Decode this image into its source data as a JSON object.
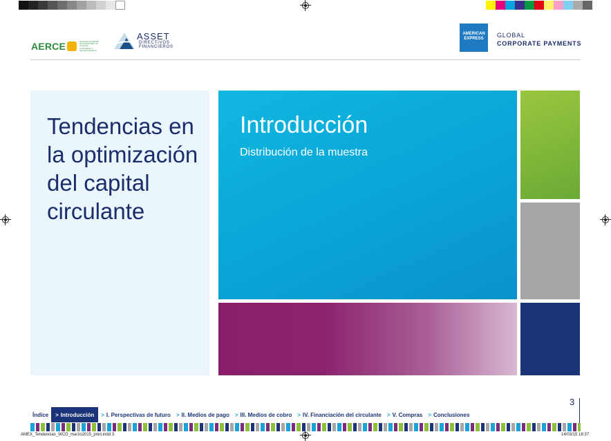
{
  "header": {
    "aerce_logo": "AERCE",
    "aerce_tagline": "Asociación Española de Profesionales de Compras, Contratación y Aprovisionamiento",
    "asset_logo": "ASSET",
    "asset_sub1": "DIRECTIVOS",
    "asset_sub2": "FINANCIEROS",
    "amex_logo_line1": "AMERICAN",
    "amex_logo_line2": "EXPRESS",
    "gcp_line1": "GLOBAL",
    "gcp_line2": "CORPORATE PAYMENTS"
  },
  "document": {
    "title": "Tendencias en la optimización del capital circulante",
    "section_title": "Introducción",
    "section_subtitle": "Distribución de la muestra"
  },
  "footer": {
    "page_number": "3",
    "nav": [
      {
        "label": "Índice",
        "arrow": "",
        "active": false
      },
      {
        "label": "Introducción",
        "arrow": ">",
        "active": true
      },
      {
        "label": "I. Perspectivas de futuro",
        "arrow": ">",
        "active": false
      },
      {
        "label": "II. Medios de pago",
        "arrow": ">",
        "active": false
      },
      {
        "label": "III. Medios de cobro",
        "arrow": ">",
        "active": false
      },
      {
        "label": "IV. Financiación del circulante",
        "arrow": ">",
        "active": false
      },
      {
        "label": "V. Compras",
        "arrow": ">",
        "active": false
      },
      {
        "label": "Conclusiones",
        "arrow": ">",
        "active": false
      }
    ],
    "slug_file": "AMEX_Tendencias_WCO_marzo2015_print.indd   3",
    "slug_date": "14/03/15   18:37"
  },
  "colors": {
    "navy": "#1b3378",
    "cyan": "#0aa8d8",
    "green": "#8ebf3b",
    "gray": "#a7a5a7",
    "purple": "#8a1e6d"
  }
}
